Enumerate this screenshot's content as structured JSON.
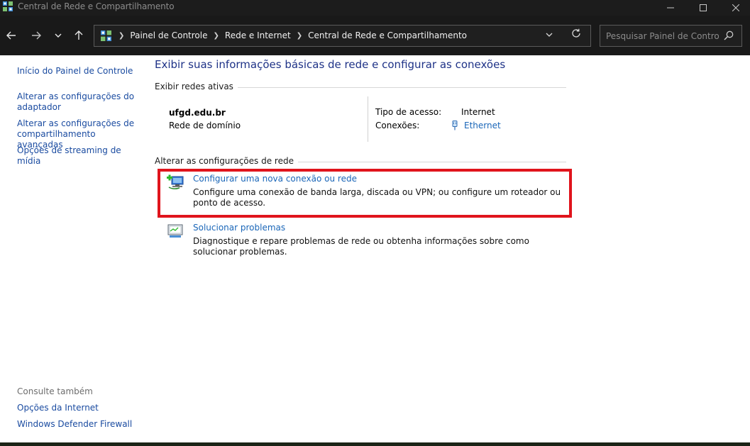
{
  "window": {
    "title": "Central de Rede e Compartilhamento",
    "icon": "network-center-icon",
    "controls": {
      "minimize": "minimize-icon",
      "maximize": "maximize-icon",
      "close": "close-icon"
    }
  },
  "toolbar": {
    "breadcrumbs": [
      "Painel de Controle",
      "Rede e Internet",
      "Central de Rede e Compartilhamento"
    ],
    "search_placeholder": "Pesquisar Painel de Controle"
  },
  "sidebar": {
    "home_link": "Início do Painel de Controle",
    "links": [
      "Alterar as configurações do adaptador",
      "Alterar as configurações de compartilhamento avançadas",
      "Opções de streaming de mídia"
    ],
    "see_also": {
      "title": "Consulte também",
      "links": [
        "Opções da Internet",
        "Windows Defender Firewall"
      ]
    }
  },
  "main": {
    "title": "Exibir suas informações básicas de rede e configurar as conexões",
    "active_networks": {
      "heading": "Exibir redes ativas",
      "network_name": "ufgd.edu.br",
      "network_type": "Rede de domínio",
      "access_type_label": "Tipo de acesso:",
      "access_type_value": "Internet",
      "connections_label": "Conexões:",
      "connection_link": "Ethernet"
    },
    "change_settings": {
      "heading": "Alterar as configurações de rede",
      "tasks": [
        {
          "link": "Configurar uma nova conexão ou rede",
          "description": "Configure uma conexão de banda larga, discada ou VPN; ou configure um roteador ou ponto de acesso.",
          "icon": "new-connection-icon"
        },
        {
          "link": "Solucionar problemas",
          "description": "Diagnostique e repare problemas de rede ou obtenha informações sobre como solucionar problemas.",
          "icon": "troubleshoot-icon"
        }
      ]
    }
  },
  "colors": {
    "link": "#1a66b8",
    "title": "#1e3287",
    "highlight": "#e0141c",
    "chrome": "#191919"
  }
}
